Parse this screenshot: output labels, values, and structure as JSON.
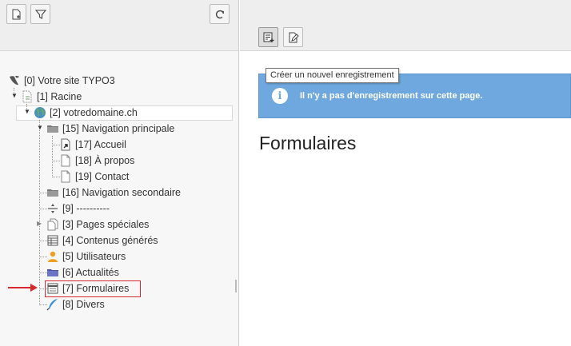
{
  "colors": {
    "info_bg": "#6ea8de",
    "highlight": "#d9282d"
  },
  "left_toolbar": {
    "buttons": [
      "new-page-icon",
      "filter-icon",
      "refresh-icon"
    ]
  },
  "tree": [
    {
      "id": "0",
      "label": "[0] Votre site TYPO3",
      "icon": "typo3-icon"
    },
    {
      "id": "1",
      "label": "[1] Racine",
      "icon": "page-root-icon"
    },
    {
      "id": "2",
      "label": "[2] votredomaine.ch",
      "icon": "globe-icon"
    },
    {
      "id": "15",
      "label": "[15] Navigation principale",
      "icon": "folder-icon"
    },
    {
      "id": "17",
      "label": "[17] Accueil",
      "icon": "page-shortcut-icon"
    },
    {
      "id": "18",
      "label": "[18] À propos",
      "icon": "page-icon"
    },
    {
      "id": "19",
      "label": "[19] Contact",
      "icon": "page-icon"
    },
    {
      "id": "16",
      "label": "[16] Navigation secondaire",
      "icon": "folder-icon"
    },
    {
      "id": "9",
      "label": "[9] ----------",
      "icon": "spacer-icon"
    },
    {
      "id": "3",
      "label": "[3] Pages spéciales",
      "icon": "pages-icon"
    },
    {
      "id": "4",
      "label": "[4] Contenus générés",
      "icon": "table-icon"
    },
    {
      "id": "5",
      "label": "[5] Utilisateurs",
      "icon": "users-icon"
    },
    {
      "id": "6",
      "label": "[6] Actualités",
      "icon": "news-folder-icon"
    },
    {
      "id": "7",
      "label": "[7] Formulaires",
      "icon": "forms-icon"
    },
    {
      "id": "8",
      "label": "[8] Divers",
      "icon": "feather-icon"
    }
  ],
  "right_toolbar": {
    "buttons": [
      "new-record-icon",
      "edit-page-icon"
    ],
    "tooltip": "Créer un nouvel enregistrement"
  },
  "info_message": "Il n'y a pas d'enregistrement sur cette page.",
  "page_heading": "Formulaires"
}
